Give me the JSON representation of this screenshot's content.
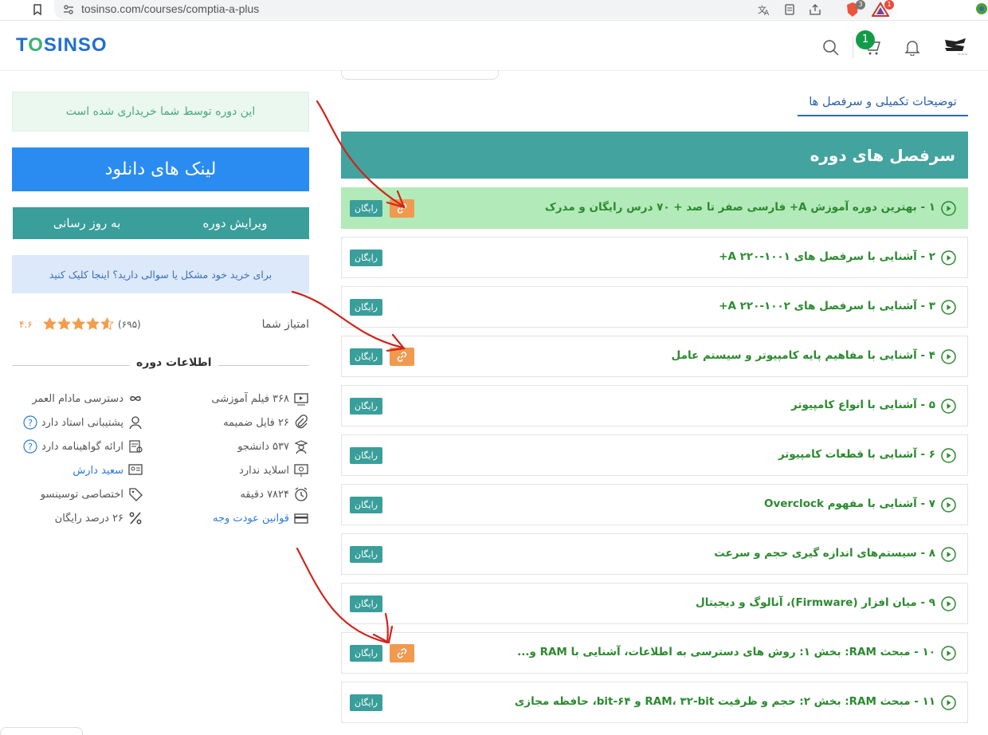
{
  "browser": {
    "url": "tosinso.com/courses/comptia-a-plus",
    "brave_badge": "3",
    "alert_badge": "1"
  },
  "header": {
    "logo_part1": "T",
    "logo_o": "O",
    "logo_part2": "SINSO",
    "cart_count": "1",
    "accent_color": "#1f6fd1"
  },
  "sidebar": {
    "purchased_text": "این دوره توسط شما خریداری شده است",
    "download_label": "لینک های دانلود",
    "edit_label": "ویرایش دوره",
    "update_label": "به روز رسانی",
    "help_text": "برای خرید خود مشکل یا سوالی دارید؟ اینجا کلیک کنید",
    "rating_label": "امتیاز شما",
    "rating_count": "(۶۹۵)",
    "rating_value": "۴.۶",
    "rating_stars": 4.6,
    "info_title": "اطلاعات دوره",
    "info": [
      {
        "right": {
          "icon": "video-icon",
          "text": "۳۶۸ فیلم آموزشی"
        },
        "left": {
          "icon": "infinity-icon",
          "text": "دسترسی مادام العمر"
        }
      },
      {
        "right": {
          "icon": "paperclip-icon",
          "text": "۲۶ فایل ضمیمه"
        },
        "left": {
          "icon": "support-icon",
          "text": "پشتیبانی استاد دارد",
          "help": true
        }
      },
      {
        "right": {
          "icon": "student-icon",
          "text": "۵۳۷ دانشجو"
        },
        "left": {
          "icon": "certificate-icon",
          "text": "ارائه گواهینامه دارد",
          "help": true
        }
      },
      {
        "right": {
          "icon": "slides-icon",
          "text": "اسلاید ندارد"
        },
        "left": {
          "icon": "teacher-icon",
          "text": "سعید دارش",
          "link": true
        }
      },
      {
        "right": {
          "icon": "clock-icon",
          "text": "۷۸۲۴ دقیقه"
        },
        "left": {
          "icon": "tag-icon",
          "text": "اختصاصی توسینسو"
        }
      },
      {
        "right": {
          "icon": "card-icon",
          "text": "قوانین عودت وجه",
          "link": true
        },
        "left": {
          "icon": "percent-icon",
          "text": "۲۶ درصد رایگان"
        }
      }
    ]
  },
  "content": {
    "tab_label": "توضیحات تکمیلی و سرفصل ها",
    "section_title": "سرفصل های دوره",
    "free_label": "رایگان",
    "lessons": [
      {
        "title": "۱ - بهترین دوره آموزش A+ فارسی صفر تا صد + ۷۰ درس رایگان و مدرک",
        "attachment": true,
        "highlighted": true
      },
      {
        "title": "۲ - آشنایی با سرفصل های ۱۰۰۱-۲۲۰ A+",
        "attachment": false,
        "highlighted": false
      },
      {
        "title": "۳ - آشنایی با سرفصل های ۱۰۰۲-۲۲۰ A+",
        "attachment": false,
        "highlighted": false
      },
      {
        "title": "۴ - آشنایی با مفاهیم پایه کامپیوتر و سیستم عامل",
        "attachment": true,
        "highlighted": false
      },
      {
        "title": "۵ - آشنایی با انواع کامپیوتر",
        "attachment": false,
        "highlighted": false
      },
      {
        "title": "۶ - آشنایی با قطعات کامپیوتر",
        "attachment": false,
        "highlighted": false
      },
      {
        "title": "۷ - آشنایی با مفهوم Overclock",
        "attachment": false,
        "highlighted": false
      },
      {
        "title": "۸ - سیستم‌های اندازه گیری حجم و سرعت",
        "attachment": false,
        "highlighted": false
      },
      {
        "title": "۹ - میان افزار (Firmware)، آنالوگ و دیجیتال",
        "attachment": false,
        "highlighted": false
      },
      {
        "title": "۱۰ - مبحث RAM: بخش ۱: روش های دسترسی به اطلاعات، آشنایی با RAM و...",
        "attachment": true,
        "highlighted": false
      },
      {
        "title": "۱۱ - مبحث RAM: بخش ۲: حجم و ظرفیت RAM، ۳۲-bit و ۶۴-bit، حافظه مجازی",
        "attachment": false,
        "highlighted": false
      }
    ]
  },
  "colors": {
    "teal": "#3a9e9a",
    "download_blue": "#2a8cf1",
    "attachment_orange": "#f19a4f",
    "lesson_green": "#2b8a2f",
    "annotation_red": "#d0241b"
  }
}
